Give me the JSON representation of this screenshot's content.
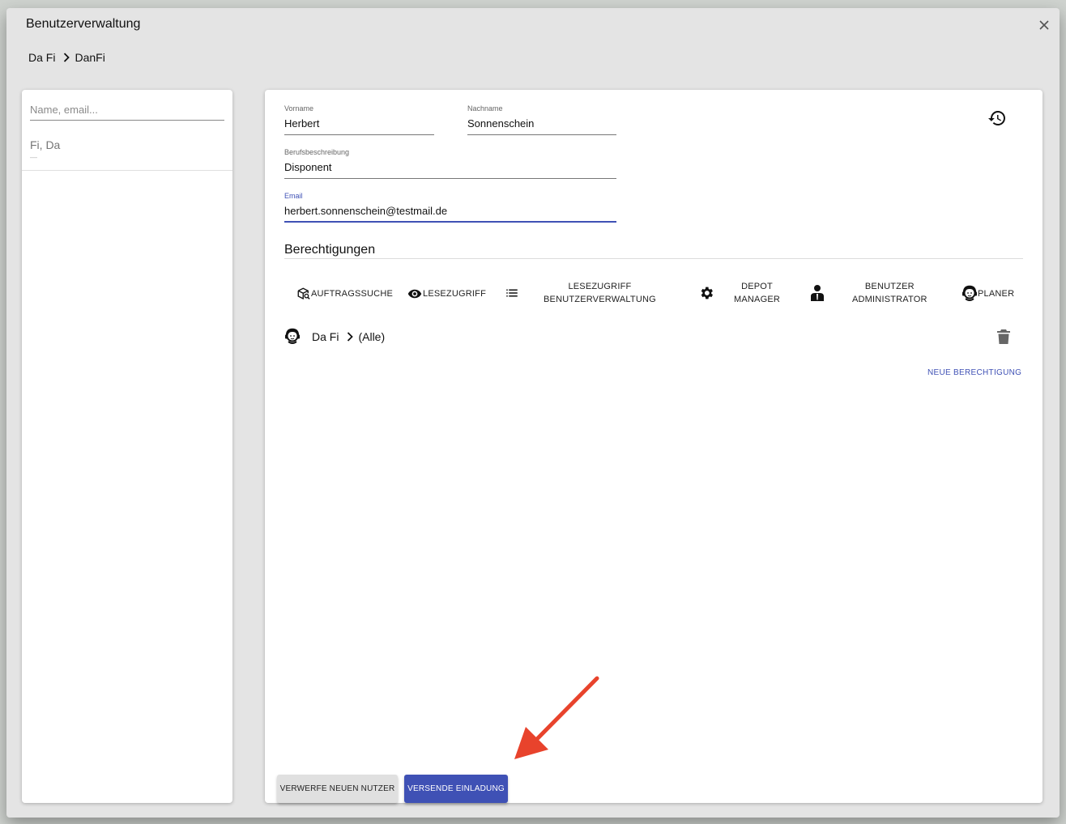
{
  "dialog": {
    "title": "Benutzerverwaltung",
    "breadcrumb": [
      "Da Fi",
      "DanFi"
    ]
  },
  "sidebar": {
    "search_placeholder": "Name, email...",
    "search_value": "",
    "users": [
      {
        "name": "Fi, Da",
        "sub": "—"
      }
    ]
  },
  "form": {
    "firstname_label": "Vorname",
    "firstname_value": "Herbert",
    "lastname_label": "Nachname",
    "lastname_value": "Sonnenschein",
    "job_label": "Berufsbeschreibung",
    "job_value": "Disponent",
    "email_label": "Email",
    "email_value": "herbert.sonnenschein@testmail.de"
  },
  "permissions": {
    "title": "Berechtigungen",
    "types": [
      {
        "label": "AUFTRAGSSUCHE",
        "icon": "package-search-icon"
      },
      {
        "label": "LESEZUGRIFF",
        "icon": "eye-icon"
      },
      {
        "label_line1": "LESEZUGRIFF",
        "label_line2": "BENUTZERVERWALTUNG",
        "icon": "list-icon"
      },
      {
        "label_line1": "DEPOT",
        "label_line2": "MANAGER",
        "icon": "gear-icon"
      },
      {
        "label_line1": "BENUTZER",
        "label_line2": "ADMINISTRATOR",
        "icon": "admin-person-icon"
      },
      {
        "label": "PLANER",
        "icon": "headset-person-icon"
      }
    ],
    "assigned": [
      {
        "name": "Da Fi",
        "scope": "(Alle)",
        "icon": "headset-person-icon"
      }
    ],
    "new_label": "NEUE BERECHTIGUNG"
  },
  "actions": {
    "discard_label": "VERWERFE NEUEN NUTZER",
    "send_label": "VERSENDE EINLADUNG"
  },
  "colors": {
    "primary": "#3f51b5",
    "annotation_arrow": "#e8432c"
  }
}
